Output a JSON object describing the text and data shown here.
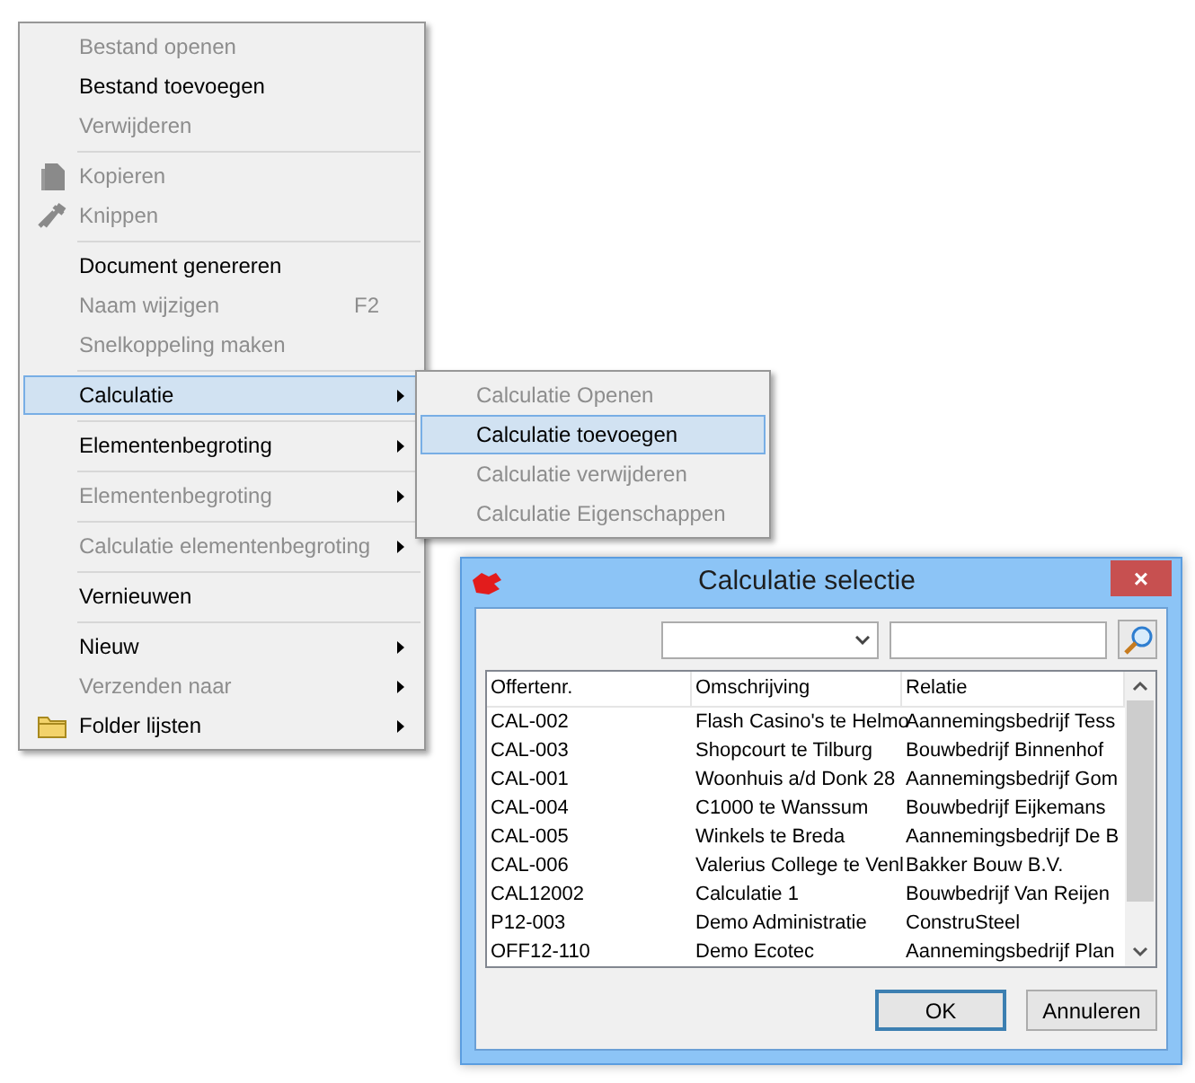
{
  "context_menu": {
    "items": [
      {
        "kind": "item",
        "label": "Bestand openen",
        "disabled": true,
        "selected": false,
        "submenu": false
      },
      {
        "kind": "item",
        "label": "Bestand toevoegen",
        "disabled": false,
        "selected": false,
        "submenu": false
      },
      {
        "kind": "item",
        "label": "Verwijderen",
        "disabled": true,
        "selected": false,
        "submenu": false
      },
      {
        "kind": "separator"
      },
      {
        "kind": "copy",
        "label": "Kopieren",
        "disabled": true,
        "selected": false,
        "submenu": false
      },
      {
        "kind": "cut",
        "label": "Knippen",
        "disabled": true,
        "selected": false,
        "submenu": false
      },
      {
        "kind": "separator"
      },
      {
        "kind": "item",
        "label": "Document genereren",
        "disabled": false,
        "selected": false,
        "submenu": false
      },
      {
        "kind": "item",
        "label": "Naam wijzigen",
        "disabled": true,
        "selected": false,
        "submenu": false,
        "shortcut": "F2"
      },
      {
        "kind": "item",
        "label": "Snelkoppeling maken",
        "disabled": true,
        "selected": false,
        "submenu": false
      },
      {
        "kind": "separator"
      },
      {
        "kind": "item",
        "label": "Calculatie",
        "disabled": false,
        "selected": true,
        "submenu": true
      },
      {
        "kind": "separator"
      },
      {
        "kind": "item",
        "label": "Elementenbegroting",
        "disabled": false,
        "selected": false,
        "submenu": true
      },
      {
        "kind": "separator"
      },
      {
        "kind": "item",
        "label": "Elementenbegroting",
        "disabled": true,
        "selected": false,
        "submenu": true
      },
      {
        "kind": "separator"
      },
      {
        "kind": "item",
        "label": "Calculatie elementenbegroting",
        "disabled": true,
        "selected": false,
        "submenu": true
      },
      {
        "kind": "separator"
      },
      {
        "kind": "item",
        "label": "Vernieuwen",
        "disabled": false,
        "selected": false,
        "submenu": false
      },
      {
        "kind": "separator"
      },
      {
        "kind": "item",
        "label": "Nieuw",
        "disabled": false,
        "selected": false,
        "submenu": true
      },
      {
        "kind": "item",
        "label": "Verzenden naar",
        "disabled": true,
        "selected": false,
        "submenu": true
      },
      {
        "kind": "folder",
        "label": "Folder lijsten",
        "disabled": false,
        "selected": false,
        "submenu": true
      }
    ]
  },
  "submenu": {
    "items": [
      {
        "label": "Calculatie Openen",
        "disabled": true,
        "selected": false
      },
      {
        "label": "Calculatie toevoegen",
        "disabled": false,
        "selected": true
      },
      {
        "label": "Calculatie verwijderen",
        "disabled": true,
        "selected": false
      },
      {
        "label": "Calculatie Eigenschappen",
        "disabled": true,
        "selected": false
      }
    ]
  },
  "dialog": {
    "title": "Calculatie selectie",
    "close": "×",
    "columns": [
      "Offertenr.",
      "Omschrijving",
      "Relatie"
    ],
    "rows": [
      [
        "CAL-002",
        "Flash Casino's te Helmo",
        "Aannemingsbedrijf Tess"
      ],
      [
        "CAL-003",
        "Shopcourt te Tilburg",
        "Bouwbedrijf Binnenhof"
      ],
      [
        "CAL-001",
        "Woonhuis a/d Donk 28",
        "Aannemingsbedrijf Gom"
      ],
      [
        "CAL-004",
        "C1000 te Wanssum",
        "Bouwbedrijf Eijkemans"
      ],
      [
        "CAL-005",
        "Winkels te Breda",
        "Aannemingsbedrijf De B"
      ],
      [
        "CAL-006",
        "Valerius College te Venl",
        "Bakker Bouw B.V."
      ],
      [
        "CAL12002",
        "Calculatie 1",
        "Bouwbedrijf Van Reijen"
      ],
      [
        "P12-003",
        "Demo Administratie",
        "ConstruSteel"
      ],
      [
        "OFF12-110",
        "Demo Ecotec",
        "Aannemingsbedrijf Plan"
      ]
    ],
    "buttons": [
      {
        "label": "OK",
        "default": true
      },
      {
        "label": "Annuleren",
        "default": false
      }
    ]
  }
}
